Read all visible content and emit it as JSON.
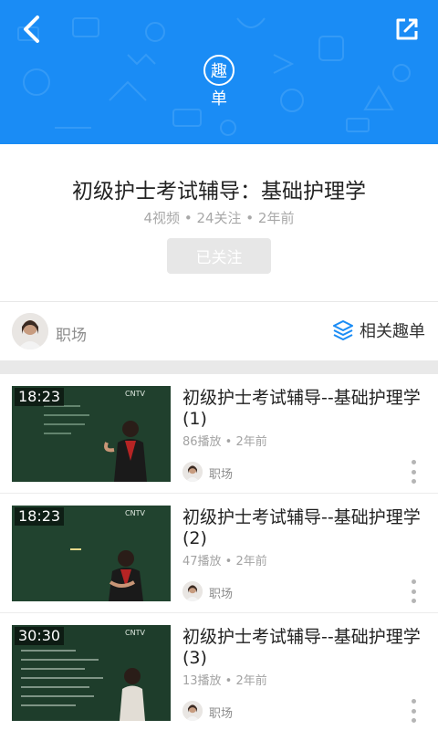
{
  "header": {
    "badge_char": "趣",
    "badge_sub": "单",
    "back_icon": "back-arrow-icon",
    "share_icon": "share-external-icon",
    "color": "#1a8cf5"
  },
  "playlist": {
    "title": "初级护士考试辅导：基础护理学",
    "meta": "4视频 • 24关注 • 2年前",
    "follow_label": "已关注"
  },
  "author": {
    "name": "职场"
  },
  "related": {
    "label": "相关趣单",
    "icon": "layers-icon",
    "icon_color": "#1a8cf5"
  },
  "videos": [
    {
      "duration": "18:23",
      "title": "初级护士考试辅导--基础护理学 (1)",
      "meta": "86播放 • 2年前",
      "author": "职场"
    },
    {
      "duration": "18:23",
      "title": "初级护士考试辅导--基础护理学 (2)",
      "meta": "47播放 • 2年前",
      "author": "职场"
    },
    {
      "duration": "30:30",
      "title": "初级护士考试辅导--基础护理学 (3)",
      "meta": "13播放 • 2年前",
      "author": "职场"
    }
  ]
}
